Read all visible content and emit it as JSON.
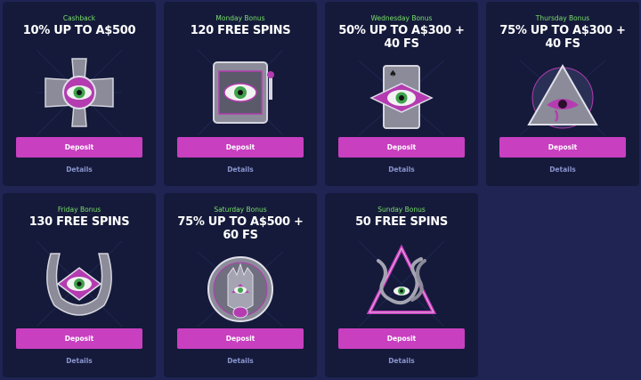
{
  "cards": [
    {
      "subtitle": "Cashback",
      "title": "10% UP TO A$500",
      "deposit": "Deposit",
      "details": "Details",
      "icon": "celtic-cross-eye-icon"
    },
    {
      "subtitle": "Monday Bonus",
      "title": "120 FREE SPINS",
      "deposit": "Deposit",
      "details": "Details",
      "icon": "slot-machine-eye-icon"
    },
    {
      "subtitle": "Wednesday Bonus",
      "title": "50% UP TO A$300 + 40 FS",
      "deposit": "Deposit",
      "details": "Details",
      "icon": "card-eye-icon"
    },
    {
      "subtitle": "Thursday Bonus",
      "title": "75% UP TO A$300 + 40 FS",
      "deposit": "Deposit",
      "details": "Details",
      "icon": "pyramid-eye-of-horus-icon"
    },
    {
      "subtitle": "Friday Bonus",
      "title": "130 FREE SPINS",
      "deposit": "Deposit",
      "details": "Details",
      "icon": "horseshoe-eye-icon"
    },
    {
      "subtitle": "Saturday Bonus",
      "title": "75% UP TO A$500 + 60 FS",
      "deposit": "Deposit",
      "details": "Details",
      "icon": "hamsa-coin-eye-icon"
    },
    {
      "subtitle": "Sunday Bonus",
      "title": "50 FREE SPINS",
      "deposit": "Deposit",
      "details": "Details",
      "icon": "snake-triangle-eye-icon"
    }
  ],
  "colors": {
    "page_background": "#1f2453",
    "card_background": "#151a3a",
    "subtitle": "#79e06a",
    "button": "#c83fc0",
    "details_link": "#8a95ce"
  }
}
